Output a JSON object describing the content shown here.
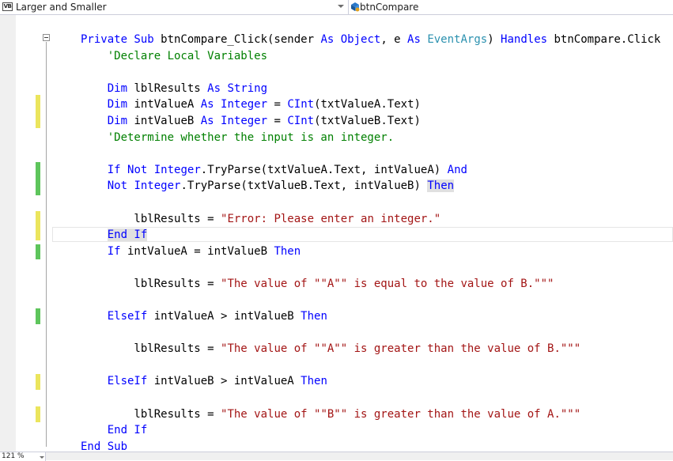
{
  "navbar": {
    "project_icon_label": "VB",
    "project_name": "Larger and Smaller",
    "member_name": "btnCompare"
  },
  "status": {
    "zoom": "121 %"
  },
  "colors": {
    "keyword": "#0000ff",
    "type": "#2b91af",
    "comment": "#008000",
    "string": "#a31515",
    "change_saved": "#5ec55c",
    "change_unsaved": "#ebe55d"
  },
  "code": {
    "lines": [
      [
        {
          "t": "kw",
          "v": "Private Sub"
        },
        {
          "t": "pl",
          "v": " btnCompare_Click(sender "
        },
        {
          "t": "kw",
          "v": "As"
        },
        {
          "t": "pl",
          "v": " "
        },
        {
          "t": "kw",
          "v": "Object"
        },
        {
          "t": "pl",
          "v": ", e "
        },
        {
          "t": "kw",
          "v": "As"
        },
        {
          "t": "pl",
          "v": " "
        },
        {
          "t": "ty",
          "v": "EventArgs"
        },
        {
          "t": "pl",
          "v": ") "
        },
        {
          "t": "kw",
          "v": "Handles"
        },
        {
          "t": "pl",
          "v": " btnCompare.Click"
        }
      ],
      [
        {
          "t": "cm",
          "v": "    'Declare Local Variables"
        }
      ],
      [],
      [
        {
          "t": "pl",
          "v": "    "
        },
        {
          "t": "kw",
          "v": "Dim"
        },
        {
          "t": "pl",
          "v": " lblResults "
        },
        {
          "t": "kw",
          "v": "As"
        },
        {
          "t": "pl",
          "v": " "
        },
        {
          "t": "kw",
          "v": "String"
        }
      ],
      [
        {
          "t": "pl",
          "v": "    "
        },
        {
          "t": "kw",
          "v": "Dim"
        },
        {
          "t": "pl",
          "v": " intValueA "
        },
        {
          "t": "kw",
          "v": "As"
        },
        {
          "t": "pl",
          "v": " "
        },
        {
          "t": "kw",
          "v": "Integer"
        },
        {
          "t": "pl",
          "v": " = "
        },
        {
          "t": "kw",
          "v": "CInt"
        },
        {
          "t": "pl",
          "v": "(txtValueA.Text)"
        }
      ],
      [
        {
          "t": "pl",
          "v": "    "
        },
        {
          "t": "kw",
          "v": "Dim"
        },
        {
          "t": "pl",
          "v": " intValueB "
        },
        {
          "t": "kw",
          "v": "As"
        },
        {
          "t": "pl",
          "v": " "
        },
        {
          "t": "kw",
          "v": "Integer"
        },
        {
          "t": "pl",
          "v": " = "
        },
        {
          "t": "kw",
          "v": "CInt"
        },
        {
          "t": "pl",
          "v": "(txtValueB.Text)"
        }
      ],
      [
        {
          "t": "cm",
          "v": "    'Determine whether the input is an integer."
        }
      ],
      [],
      [
        {
          "t": "pl",
          "v": "    "
        },
        {
          "t": "kw",
          "v": "If"
        },
        {
          "t": "pl",
          "v": " "
        },
        {
          "t": "kw",
          "v": "Not"
        },
        {
          "t": "pl",
          "v": " "
        },
        {
          "t": "kw",
          "v": "Integer"
        },
        {
          "t": "pl",
          "v": ".TryParse(txtValueA.Text, intValueA) "
        },
        {
          "t": "kw",
          "v": "And"
        }
      ],
      [
        {
          "t": "pl",
          "v": "    "
        },
        {
          "t": "kw",
          "v": "Not"
        },
        {
          "t": "pl",
          "v": " "
        },
        {
          "t": "kw",
          "v": "Integer"
        },
        {
          "t": "pl",
          "v": ".TryParse(txtValueB.Text, intValueB) "
        },
        {
          "t": "kwhl",
          "v": "Then"
        }
      ],
      [],
      [
        {
          "t": "pl",
          "v": "        lblResults = "
        },
        {
          "t": "st",
          "v": "\"Error: Please enter an integer.\""
        }
      ],
      [
        {
          "t": "pl",
          "v": "    "
        },
        {
          "t": "kwhl",
          "v": "End If"
        }
      ],
      [
        {
          "t": "pl",
          "v": "    "
        },
        {
          "t": "kw",
          "v": "If"
        },
        {
          "t": "pl",
          "v": " intValueA = intValueB "
        },
        {
          "t": "kw",
          "v": "Then"
        }
      ],
      [],
      [
        {
          "t": "pl",
          "v": "        lblResults = "
        },
        {
          "t": "st",
          "v": "\"The value of \"\"A\"\" is equal to the value of B.\"\"\""
        }
      ],
      [],
      [
        {
          "t": "pl",
          "v": "    "
        },
        {
          "t": "kw",
          "v": "ElseIf"
        },
        {
          "t": "pl",
          "v": " intValueA > intValueB "
        },
        {
          "t": "kw",
          "v": "Then"
        }
      ],
      [],
      [
        {
          "t": "pl",
          "v": "        lblResults = "
        },
        {
          "t": "st",
          "v": "\"The value of \"\"A\"\" is greater than the value of B.\"\"\""
        }
      ],
      [],
      [
        {
          "t": "pl",
          "v": "    "
        },
        {
          "t": "kw",
          "v": "ElseIf"
        },
        {
          "t": "pl",
          "v": " intValueB > intValueA "
        },
        {
          "t": "kw",
          "v": "Then"
        }
      ],
      [],
      [
        {
          "t": "pl",
          "v": "        lblResults = "
        },
        {
          "t": "st",
          "v": "\"The value of \"\"B\"\" is greater than the value of A.\"\"\""
        }
      ],
      [
        {
          "t": "pl",
          "v": "    "
        },
        {
          "t": "kw",
          "v": "End If"
        }
      ],
      [
        {
          "t": "kw",
          "v": "End Sub"
        }
      ]
    ]
  }
}
